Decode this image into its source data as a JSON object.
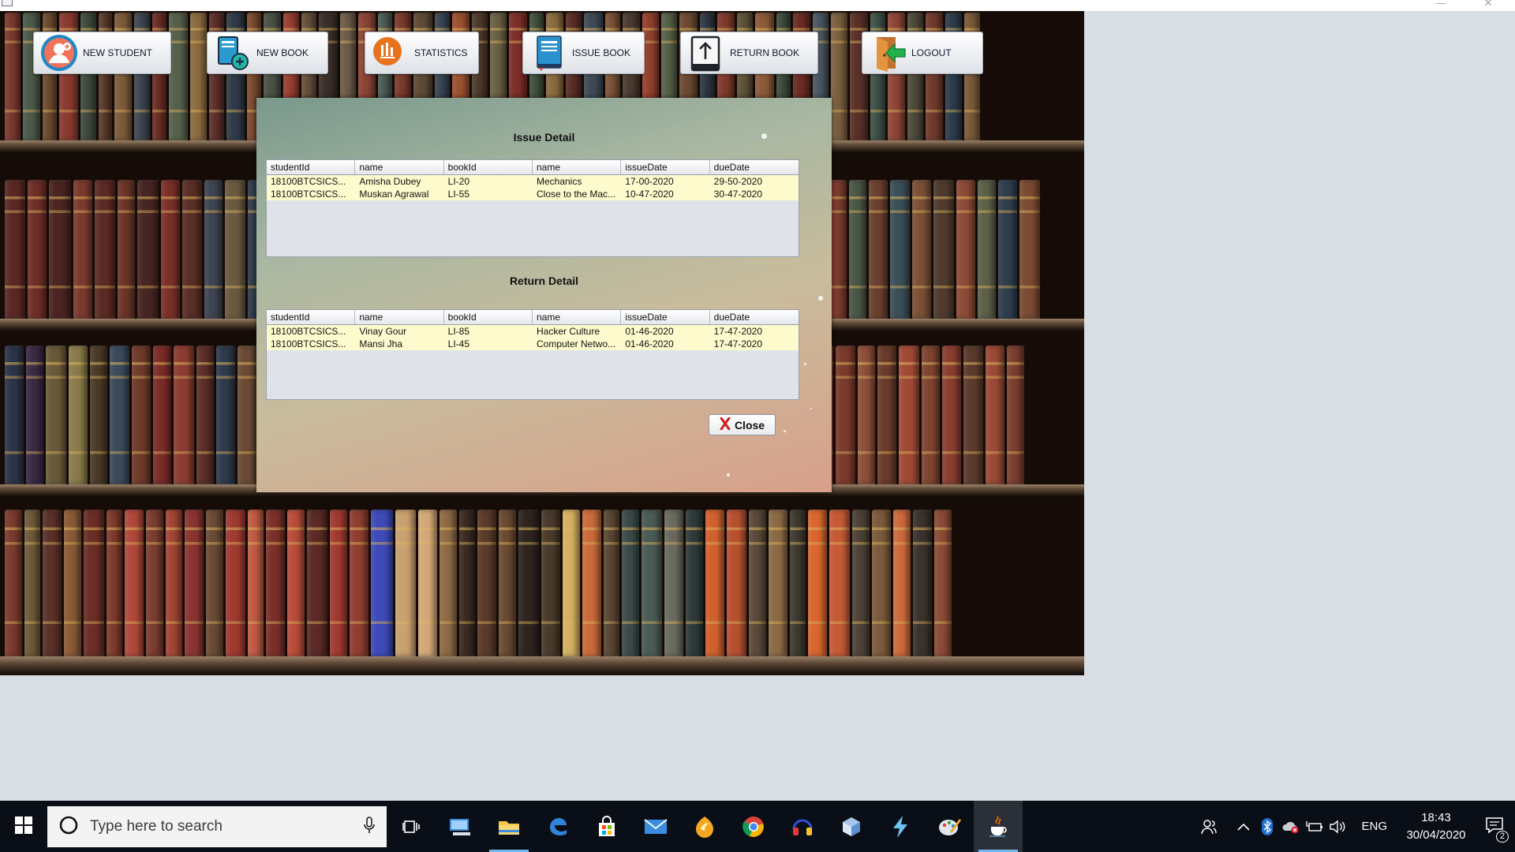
{
  "window": {
    "minimize_glyph": "—",
    "restore_glyph": "❐",
    "close_glyph": "✕"
  },
  "toolbar": {
    "buttons": [
      {
        "label": "NEW STUDENT",
        "icon": "add-user-icon"
      },
      {
        "label": "NEW BOOK",
        "icon": "add-book-icon"
      },
      {
        "label": "STATISTICS",
        "icon": "statistics-icon"
      },
      {
        "label": "ISSUE BOOK",
        "icon": "issue-book-icon"
      },
      {
        "label": "RETURN BOOK",
        "icon": "return-book-icon"
      },
      {
        "label": "LOGOUT",
        "icon": "logout-door-icon"
      }
    ]
  },
  "dialog": {
    "issue_title": "Issue Detail",
    "return_title": "Return Detail",
    "close_label": "Close",
    "columns": [
      "studentId",
      "name",
      "bookId",
      "name",
      "issueDate",
      "dueDate"
    ],
    "issue_rows": [
      [
        "18100BTCSICS...",
        "Amisha Dubey",
        "LI-20",
        "Mechanics",
        "17-00-2020",
        "29-50-2020"
      ],
      [
        "18100BTCSICS...",
        "Muskan Agrawal",
        "LI-55",
        "Close to the Mac...",
        "10-47-2020",
        "30-47-2020"
      ]
    ],
    "return_rows": [
      [
        "18100BTCSICS...",
        "Vinay Gour",
        "LI-85",
        "Hacker Culture",
        "01-46-2020",
        "17-47-2020"
      ],
      [
        "18100BTCSICS...",
        "Mansi Jha",
        "LI-45",
        "Computer Netwo...",
        "01-46-2020",
        "17-47-2020"
      ]
    ]
  },
  "taskbar": {
    "search_placeholder": "Type here to search",
    "lang": "ENG",
    "time": "18:43",
    "date": "30/04/2020",
    "notification_count": "2",
    "pinned": [
      "task-view-icon",
      "desktop-app-icon",
      "file-explorer-icon",
      "edge-icon",
      "store-icon",
      "mail-icon",
      "fl-studio-icon",
      "chrome-icon",
      "headset-app-icon",
      "3d-box-icon",
      "winamp-icon",
      "paint-icon",
      "java-icon"
    ]
  }
}
